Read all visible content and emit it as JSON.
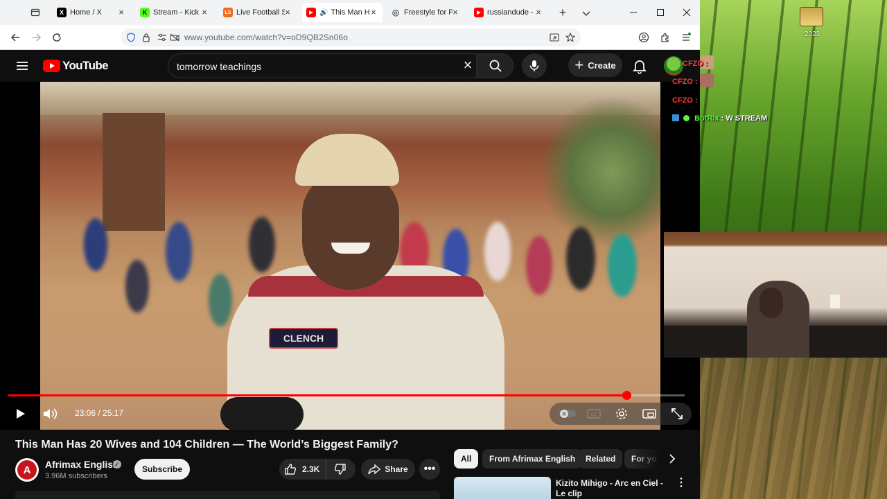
{
  "browser": {
    "tabs": [
      {
        "label": "Home / X",
        "fav_color": "#000000",
        "fav_char": "X",
        "active": false
      },
      {
        "label": "Stream - Kick Da",
        "fav_color": "#53fc18",
        "fav_char": "K",
        "active": false
      },
      {
        "label": "Live Football Sco",
        "fav_color": "#f26b1d",
        "fav_char": "LS",
        "active": false
      },
      {
        "label": "This Man Ha",
        "fav_color": "#ff0000",
        "fav_char": "▶",
        "active": true
      },
      {
        "label": "Freestyle for Par",
        "fav_color": "#5f6368",
        "fav_char": "◎",
        "active": false
      },
      {
        "label": "russiandude - Yo",
        "fav_color": "#ff0000",
        "fav_char": "▶",
        "active": false
      }
    ],
    "url": "www.youtube.com/watch?v=oD9QB2Sn06o"
  },
  "youtube": {
    "logo_text": "YouTube",
    "search_value": "tomorrow teachings",
    "create_label": "Create",
    "player": {
      "time": "23:06 / 25:17",
      "progress": 0.9137,
      "frame_patch_text": "CLENCH"
    },
    "video_title": "This Man Has 20 Wives and 104 Children — The World’s Biggest Family?",
    "channel": {
      "name": "Afrimax English",
      "subscribers": "3.96M subscribers",
      "avatar_letter": "A"
    },
    "subscribe_label": "Subscribe",
    "likes": "2.3K",
    "share_label": "Share",
    "chips": [
      "All",
      "From Afrimax English",
      "Related",
      "For yo"
    ],
    "recommendation": {
      "title": "Kizito Mihigo - Arc en Ciel - Le clip"
    }
  },
  "overlay": {
    "year": "2023",
    "chat": [
      {
        "user": "CFZO",
        "text": "CFZO :",
        "color": "#ff3b3b"
      },
      {
        "user": "CFZO",
        "text": "CFZO :",
        "color": "#ff3b3b"
      },
      {
        "user": "CFZO",
        "text": "CFZO :",
        "color": "#ff3b3b"
      },
      {
        "user": "BotRix",
        "text": ": W STREAM",
        "color": "#5df542"
      }
    ]
  }
}
